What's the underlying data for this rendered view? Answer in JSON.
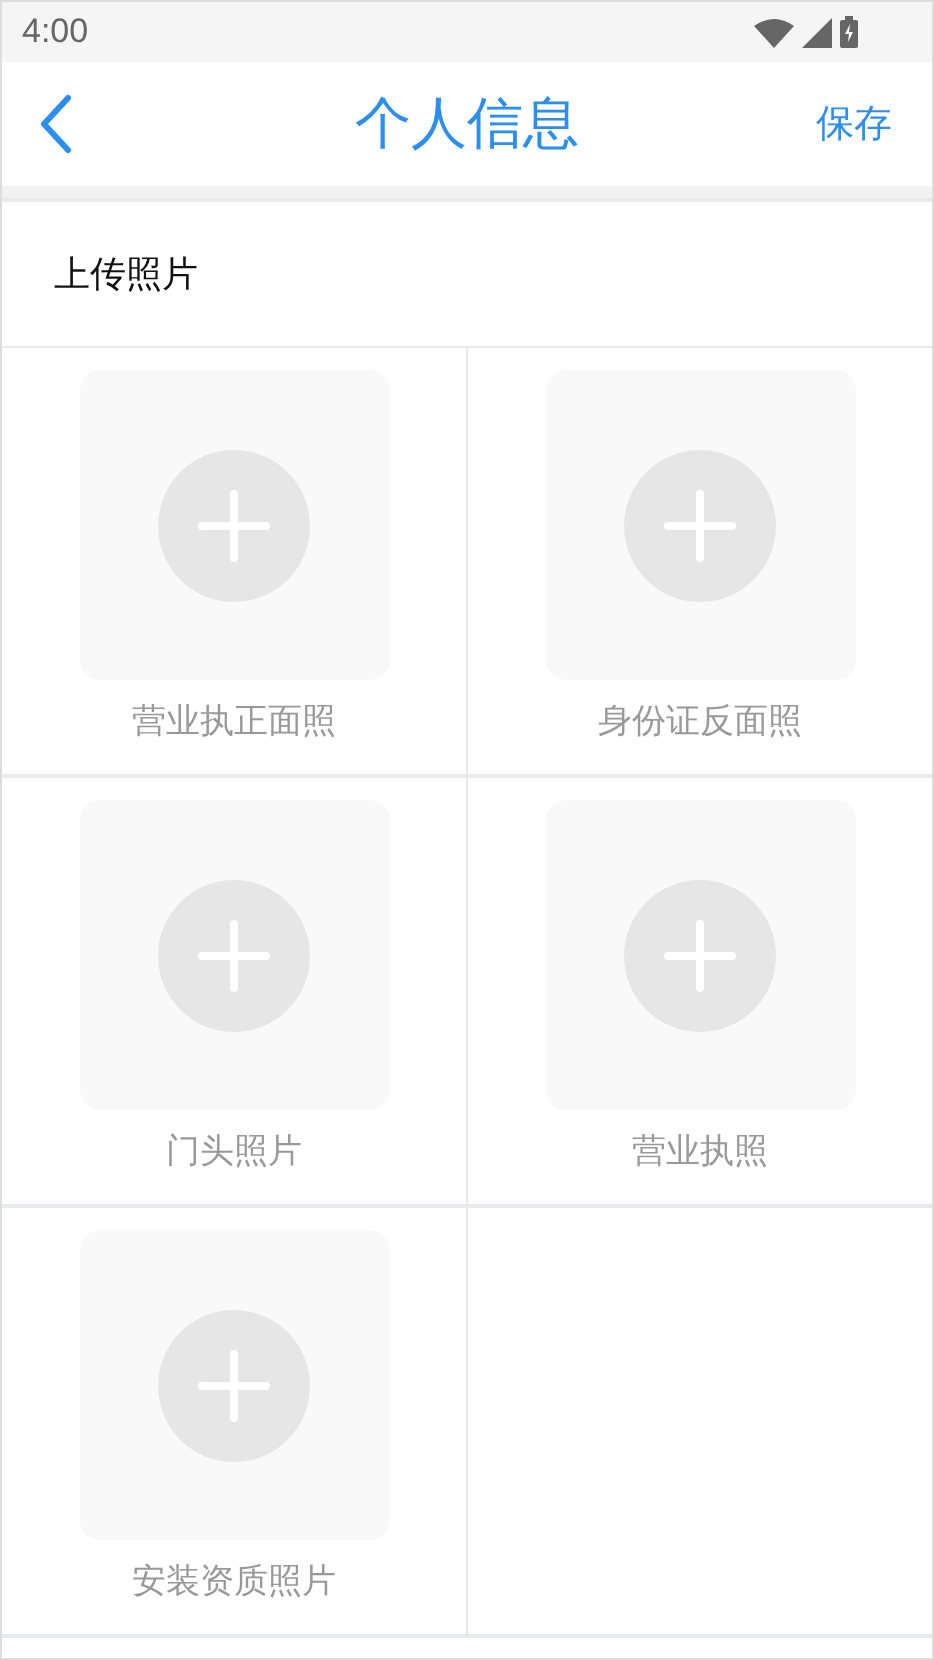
{
  "status_bar": {
    "time": "4:00"
  },
  "nav": {
    "title": "个人信息",
    "action": "保存"
  },
  "section": {
    "title": "上传照片"
  },
  "uploads": [
    {
      "label": "营业执正面照"
    },
    {
      "label": "身份证反面照"
    },
    {
      "label": "门头照片"
    },
    {
      "label": "营业执照"
    },
    {
      "label": "安装资质照片"
    }
  ]
}
